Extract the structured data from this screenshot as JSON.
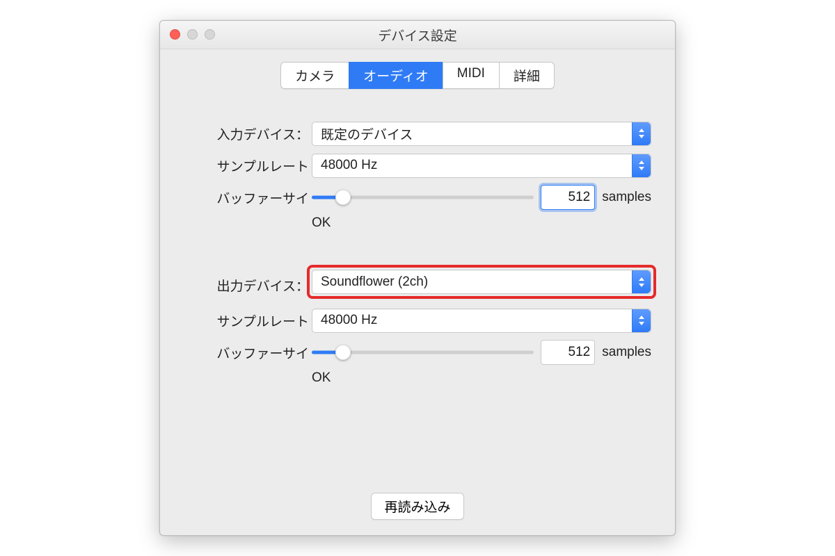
{
  "window": {
    "title": "デバイス設定"
  },
  "tabs": {
    "camera": "カメラ",
    "audio": "オーディオ",
    "midi": "MIDI",
    "advanced": "詳細",
    "active": "audio"
  },
  "labels": {
    "input_device": "入力デバイス：",
    "sample_rate": "サンプルレート",
    "buffer_size": "バッファーサイ",
    "output_device": "出力デバイス：",
    "samples_unit": "samples",
    "status_ok": "OK"
  },
  "input": {
    "device": "既定のデバイス",
    "sample_rate": "48000 Hz",
    "buffer_value": "512",
    "slider_percent": 14
  },
  "output": {
    "device": "Soundflower (2ch)",
    "sample_rate": "48000 Hz",
    "buffer_value": "512",
    "slider_percent": 14
  },
  "buttons": {
    "reload": "再読み込み"
  },
  "colors": {
    "accent": "#2f7bf6",
    "highlight": "#e52a2a"
  }
}
